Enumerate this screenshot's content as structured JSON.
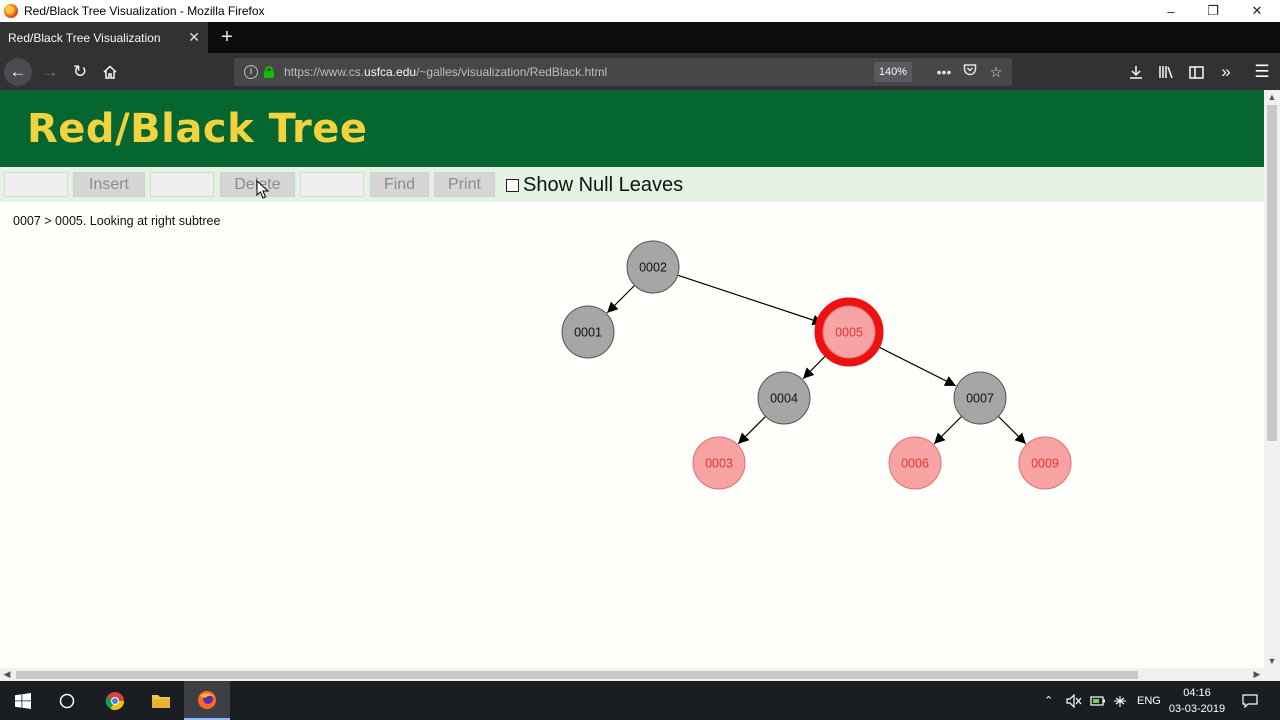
{
  "window": {
    "title": "Red/Black Tree Visualization - Mozilla Firefox"
  },
  "tabs": [
    {
      "label": "Red/Black Tree Visualization"
    }
  ],
  "navbar": {
    "url_prefix": "https://www.cs.",
    "url_domain": "usfca.edu",
    "url_suffix": "/~galles/visualization/RedBlack.html",
    "zoom": "140%"
  },
  "page": {
    "title": "Red/Black Tree",
    "controls": {
      "insert_label": "Insert",
      "delete_label": "Delete",
      "find_label": "Find",
      "print_label": "Print",
      "null_leaves_label": "Show Null Leaves",
      "null_leaves_checked": false
    },
    "status": "0007 > 0005.  Looking at right subtree"
  },
  "tree": {
    "colors": {
      "black_fill": "#a6a6a6",
      "red_fill": "#f7a3a3",
      "red_text": "#e0363a",
      "highlight": "#ee1111"
    },
    "nodes": [
      {
        "id": "n2",
        "label": "0002",
        "color": "black"
      },
      {
        "id": "n1",
        "label": "0001",
        "color": "black"
      },
      {
        "id": "n5",
        "label": "0005",
        "color": "red",
        "highlighted": true
      },
      {
        "id": "n4",
        "label": "0004",
        "color": "black"
      },
      {
        "id": "n7",
        "label": "0007",
        "color": "black"
      },
      {
        "id": "n3",
        "label": "0003",
        "color": "red"
      },
      {
        "id": "n6",
        "label": "0006",
        "color": "red"
      },
      {
        "id": "n9",
        "label": "0009",
        "color": "red"
      }
    ],
    "edges": [
      [
        "n2",
        "n1"
      ],
      [
        "n2",
        "n5"
      ],
      [
        "n5",
        "n4"
      ],
      [
        "n5",
        "n7"
      ],
      [
        "n4",
        "n3"
      ],
      [
        "n7",
        "n6"
      ],
      [
        "n7",
        "n9"
      ]
    ]
  },
  "taskbar": {
    "language": "ENG",
    "time": "04:16",
    "date": "03-03-2019"
  }
}
